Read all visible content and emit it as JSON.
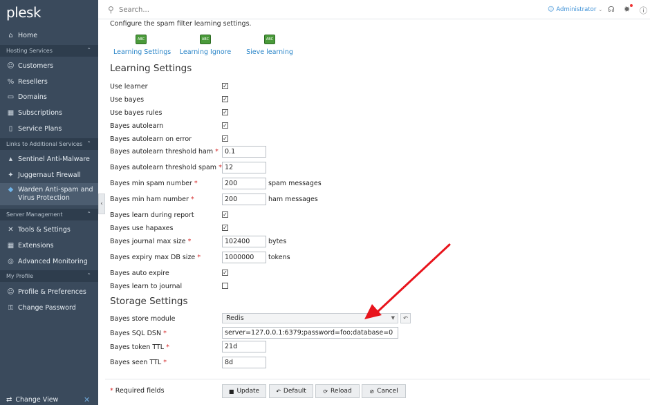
{
  "sidebar": {
    "logo": "plesk",
    "items": [
      {
        "label": "Home",
        "icon": "home-icon",
        "glyph": "⌂"
      },
      {
        "section": "Hosting Services"
      },
      {
        "label": "Customers",
        "icon": "user-icon",
        "glyph": "☺"
      },
      {
        "label": "Resellers",
        "icon": "percent-icon",
        "glyph": "%"
      },
      {
        "label": "Domains",
        "icon": "monitor-icon",
        "glyph": "▭"
      },
      {
        "label": "Subscriptions",
        "icon": "grid-icon",
        "glyph": "▦"
      },
      {
        "label": "Service Plans",
        "icon": "book-icon",
        "glyph": "▯"
      },
      {
        "section": "Links to Additional Services"
      },
      {
        "label": "Sentinel Anti-Malware",
        "icon": "sentinel-icon",
        "glyph": "▲"
      },
      {
        "label": "Juggernaut Firewall",
        "icon": "firewall-icon",
        "glyph": "✦"
      },
      {
        "label": "Warden Anti-spam and Virus Protection",
        "icon": "shield-icon",
        "glyph": "◆"
      },
      {
        "section": "Server Management"
      },
      {
        "label": "Tools & Settings",
        "icon": "tools-icon",
        "glyph": "✕"
      },
      {
        "label": "Extensions",
        "icon": "extensions-icon",
        "glyph": "▦"
      },
      {
        "label": "Advanced Monitoring",
        "icon": "monitoring-icon",
        "glyph": "◎"
      },
      {
        "section": "My Profile"
      },
      {
        "label": "Profile & Preferences",
        "icon": "profile-icon",
        "glyph": "☺"
      },
      {
        "label": "Change Password",
        "icon": "key-icon",
        "glyph": "⚿"
      }
    ],
    "change_view": "Change View"
  },
  "header": {
    "search_placeholder": "Search...",
    "user": "Administrator"
  },
  "intro": "Configure the spam filter learning settings.",
  "tools": [
    {
      "label": "Learning Settings",
      "icon_text": "ABC"
    },
    {
      "label": "Learning Ignore",
      "icon_text": "ABC"
    },
    {
      "label": "Sieve learning",
      "icon_text": "ABC"
    }
  ],
  "learning": {
    "heading": "Learning Settings",
    "fields": [
      {
        "label": "Use learner",
        "type": "checkbox",
        "checked": true
      },
      {
        "label": "Use bayes",
        "type": "checkbox",
        "checked": true
      },
      {
        "label": "Use bayes rules",
        "type": "checkbox",
        "checked": true
      },
      {
        "label": "Bayes autolearn",
        "type": "checkbox",
        "checked": true
      },
      {
        "label": "Bayes autolearn on error",
        "type": "checkbox",
        "checked": true
      },
      {
        "label": "Bayes autolearn threshold ham",
        "type": "input",
        "required": true,
        "value": "0.1"
      },
      {
        "label": "Bayes autolearn threshold spam",
        "type": "input",
        "required": true,
        "value": "12"
      },
      {
        "label": "Bayes min spam number",
        "type": "input",
        "required": true,
        "value": "200",
        "unit": "spam messages"
      },
      {
        "label": "Bayes min ham number",
        "type": "input",
        "required": true,
        "value": "200",
        "unit": "ham messages"
      },
      {
        "label": "Bayes learn during report",
        "type": "checkbox",
        "checked": true
      },
      {
        "label": "Bayes use hapaxes",
        "type": "checkbox",
        "checked": true
      },
      {
        "label": "Bayes journal max size",
        "type": "input",
        "required": true,
        "value": "102400",
        "unit": "bytes"
      },
      {
        "label": "Bayes expiry max DB size",
        "type": "input",
        "required": true,
        "value": "1000000",
        "unit": "tokens"
      },
      {
        "label": "Bayes auto expire",
        "type": "checkbox",
        "checked": true
      },
      {
        "label": "Bayes learn to journal",
        "type": "checkbox",
        "checked": false
      }
    ]
  },
  "storage": {
    "heading": "Storage Settings",
    "store_module_label": "Bayes store module",
    "store_module_value": "Redis",
    "sql_dsn_label": "Bayes SQL DSN",
    "sql_dsn_value": "server=127.0.0.1:6379;password=foo;database=0",
    "token_ttl_label": "Bayes token TTL",
    "token_ttl_value": "21d",
    "seen_ttl_label": "Bayes seen TTL",
    "seen_ttl_value": "8d"
  },
  "footer": {
    "required_note": "Required fields",
    "buttons": [
      "Update",
      "Default",
      "Reload",
      "Cancel"
    ]
  },
  "colors": {
    "accent": "#2a85c8",
    "required": "#d62c2c",
    "arrow": "#e8141c",
    "sidebar": "#3a4a5c"
  }
}
